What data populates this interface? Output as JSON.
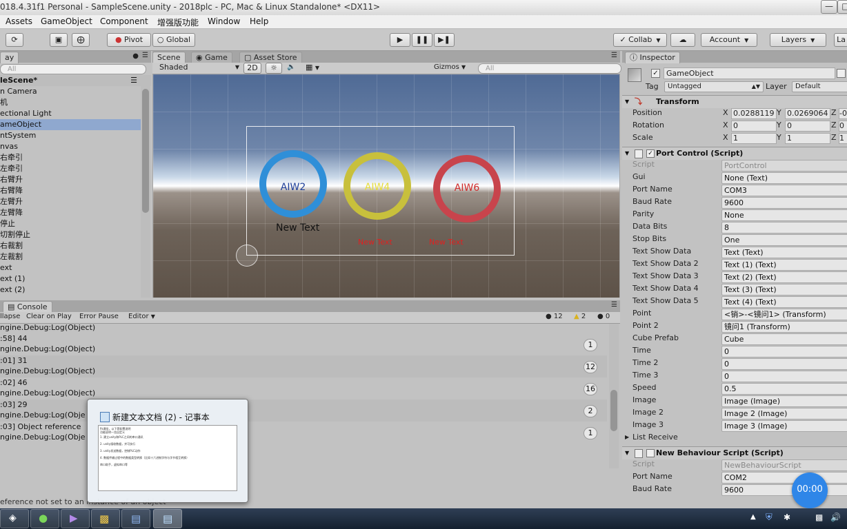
{
  "window": {
    "title": "018.4.31f1 Personal - SampleScene.unity - 2018plc - PC, Mac & Linux Standalone* <DX11>"
  },
  "menu": [
    "Assets",
    "GameObject",
    "Component",
    "增强版功能",
    "Window",
    "Help"
  ],
  "toolbar": {
    "pivot": "Pivot",
    "global": "Global",
    "collab": "Collab",
    "account": "Account",
    "layers": "Layers",
    "layout": "La"
  },
  "hierarchy": {
    "tab": "ay",
    "search_placeholder": "All",
    "scene_name": "leScene*",
    "items": [
      "n Camera",
      "机",
      "ectional Light",
      "ameObject",
      "ntSystem",
      "nvas",
      "右牵引",
      "左牵引",
      "右臂升",
      "右臂降",
      "左臂升",
      "左臂降",
      "停止",
      "切割停止",
      "右裁割",
      "左裁割",
      "ext",
      "ext (1)",
      "ext (2)"
    ],
    "selected_index": 3
  },
  "scene": {
    "tabs": [
      "Scene",
      "Game",
      "Asset Store"
    ],
    "shading": "Shaded",
    "mode_2d": "2D",
    "gizmos": "Gizmos",
    "search_placeholder": "All",
    "rings": [
      {
        "label": "AIW2",
        "ring_color": "#2f8fd8",
        "text_color": "#1e3f9a"
      },
      {
        "label": "AIW4",
        "ring_color": "#c8c03c",
        "text_color": "#e6dc3a"
      },
      {
        "label": "AIW6",
        "ring_color": "#c8444c",
        "text_color": "#cf2a2a"
      }
    ],
    "texts": {
      "main": "New Text",
      "red1": "New Text",
      "red2": "New Text"
    }
  },
  "console": {
    "tab": "Console",
    "buttons": [
      "llapse",
      "Clear on Play",
      "Error Pause",
      "Editor"
    ],
    "counts": {
      "info": "12",
      "warn": "2",
      "error": "0"
    },
    "top_partial": "ngine.Debug:Log(Object)",
    "entries": [
      {
        "line1": ":58] 44",
        "line2": "ngine.Debug:Log(Object)",
        "count": "1"
      },
      {
        "line1": ":01] 31",
        "line2": "ngine.Debug:Log(Object)",
        "count": "12"
      },
      {
        "line1": ":02] 46",
        "line2": "ngine.Debug:Log(Object)",
        "count": "16"
      },
      {
        "line1": ":03] 29",
        "line2": "ngine.Debug:Log(Obje",
        "count": "2"
      },
      {
        "line1": ":03] Object reference",
        "line2": "ngine.Debug:Log(Obje",
        "count": "1"
      }
    ],
    "status": "eference not set to an instance of an object"
  },
  "popup": {
    "title": "新建文本文档 (2) - 记事本",
    "lines": [
      "Pz通信，以下是配置说明",
      "功能说明一览自定义",
      "1. 建立unity和PLC之间的串口通讯",
      "2. unity接收数据，并可执行",
      "3. unity发送数据，控制PLC动作",
      "4. 数据传输过程中的数据类型转换（比如十六进制字符与字节相互转换）",
      "串口助手，虚拟串口等"
    ]
  },
  "inspector": {
    "tab": "Inspector",
    "object_name": "GameObject",
    "tag_label": "Tag",
    "tag": "Untagged",
    "layer_label": "Layer",
    "layer": "Default",
    "transform": {
      "title": "Transform",
      "position": {
        "label": "Position",
        "x": "0.0288119",
        "y": "0.0269064",
        "z": "-0"
      },
      "rotation": {
        "label": "Rotation",
        "x": "0",
        "y": "0",
        "z": "0"
      },
      "scale": {
        "label": "Scale",
        "x": "1",
        "y": "1",
        "z": "1"
      }
    },
    "port_control": {
      "title": "Port Control (Script)",
      "fields": [
        {
          "label": "Script",
          "value": "PortControl",
          "dim": true
        },
        {
          "label": "Gui",
          "value": "None (Text)"
        },
        {
          "label": "Port Name",
          "value": "COM3"
        },
        {
          "label": "Baud Rate",
          "value": "9600"
        },
        {
          "label": "Parity",
          "value": "None"
        },
        {
          "label": "Data Bits",
          "value": "8"
        },
        {
          "label": "Stop Bits",
          "value": "One"
        },
        {
          "label": "Text Show Data",
          "value": "Text (Text)"
        },
        {
          "label": "Text Show Data 2",
          "value": "Text (1) (Text)"
        },
        {
          "label": "Text Show Data 3",
          "value": "Text (2) (Text)"
        },
        {
          "label": "Text Show Data 4",
          "value": "Text (3) (Text)"
        },
        {
          "label": "Text Show Data 5",
          "value": "Text (4) (Text)"
        },
        {
          "label": "Point",
          "value": "<销>-<镜问1> (Transform)"
        },
        {
          "label": "Point 2",
          "value": "镜问1 (Transform)"
        },
        {
          "label": "Cube Prefab",
          "value": "Cube"
        },
        {
          "label": "Time",
          "value": "0"
        },
        {
          "label": "Time 2",
          "value": "0"
        },
        {
          "label": "Time 3",
          "value": "0"
        },
        {
          "label": "Speed",
          "value": "0.5"
        },
        {
          "label": "Image",
          "value": "Image (Image)"
        },
        {
          "label": "Image 2",
          "value": "Image 2 (Image)"
        },
        {
          "label": "Image 3",
          "value": "Image 3 (Image)"
        },
        {
          "label": "List Receive",
          "value": ""
        }
      ]
    },
    "new_behaviour": {
      "title": "New Behaviour Script (Script)",
      "fields": [
        {
          "label": "Script",
          "value": "NewBehaviourScript",
          "dim": true
        },
        {
          "label": "Port Name",
          "value": "COM2"
        },
        {
          "label": "Baud Rate",
          "value": "9600"
        }
      ]
    }
  },
  "timer": "00:00"
}
